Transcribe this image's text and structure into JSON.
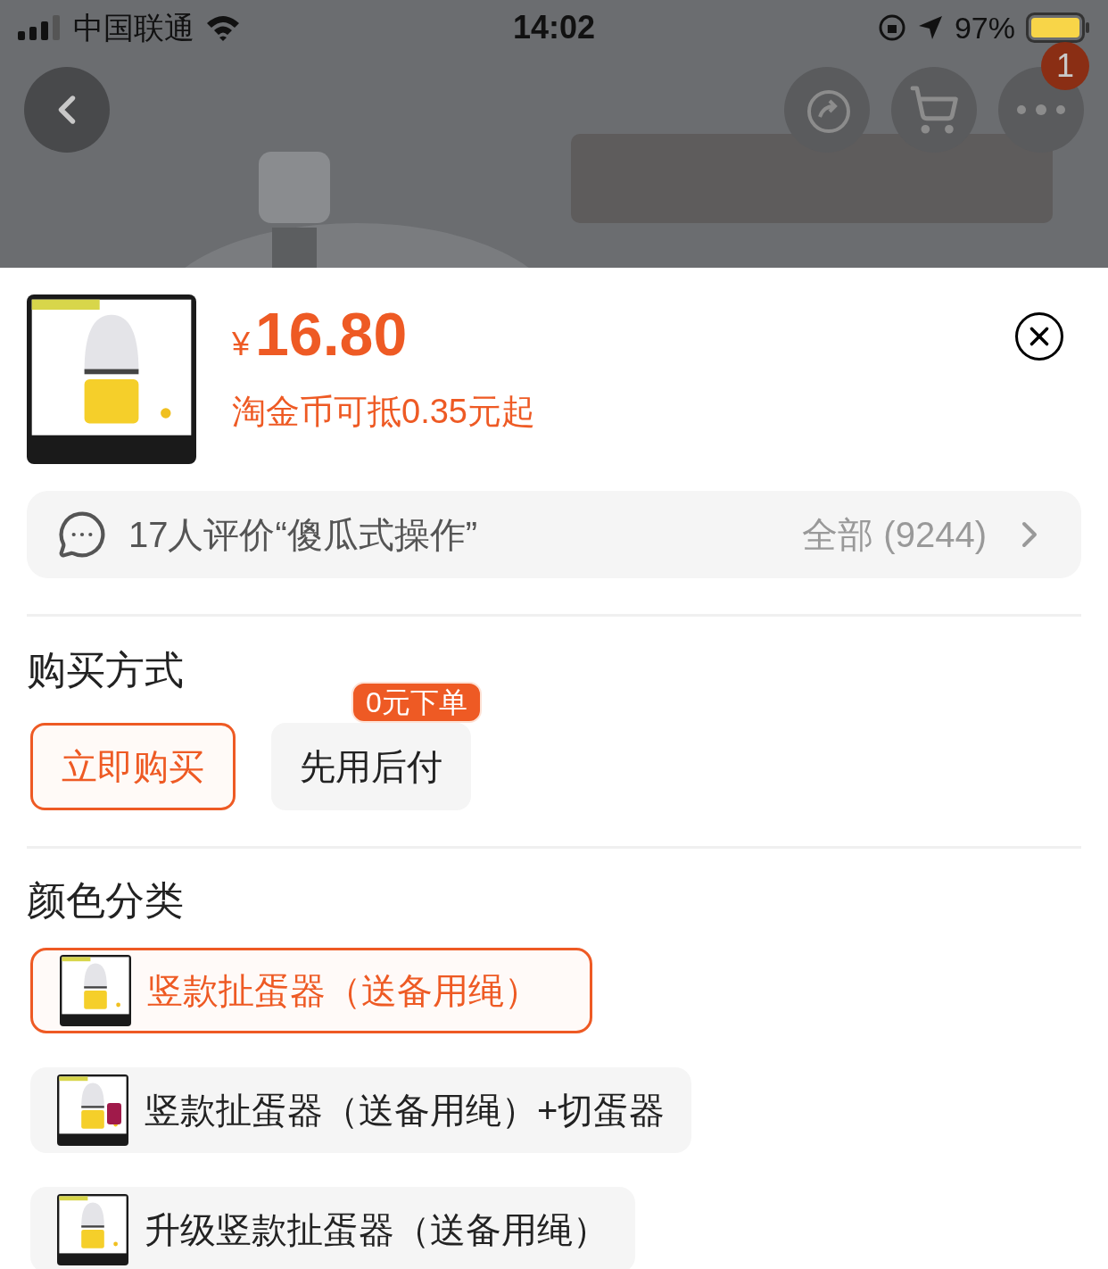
{
  "status_bar": {
    "carrier": "中国联通",
    "time": "14:02",
    "battery": "97%"
  },
  "header": {
    "badge": "1"
  },
  "product": {
    "currency": "¥",
    "price": "16.80",
    "coin_discount": "淘金币可抵0.35元起"
  },
  "reviews": {
    "summary": "17人评价“傻瓜式操作”",
    "all": "全部 (9244)"
  },
  "purchase_method": {
    "title": "购买方式",
    "options": [
      {
        "label": "立即购买",
        "selected": true
      },
      {
        "label": "先用后付",
        "selected": false,
        "badge": "0元下单"
      }
    ]
  },
  "color_category": {
    "title": "颜色分类",
    "options": [
      {
        "label": "竖款扯蛋器（送备用绳）",
        "selected": true
      },
      {
        "label": "竖款扯蛋器（送备用绳）+切蛋器",
        "selected": false
      },
      {
        "label": "升级竖款扯蛋器（送备用绳）",
        "selected": false
      }
    ]
  }
}
